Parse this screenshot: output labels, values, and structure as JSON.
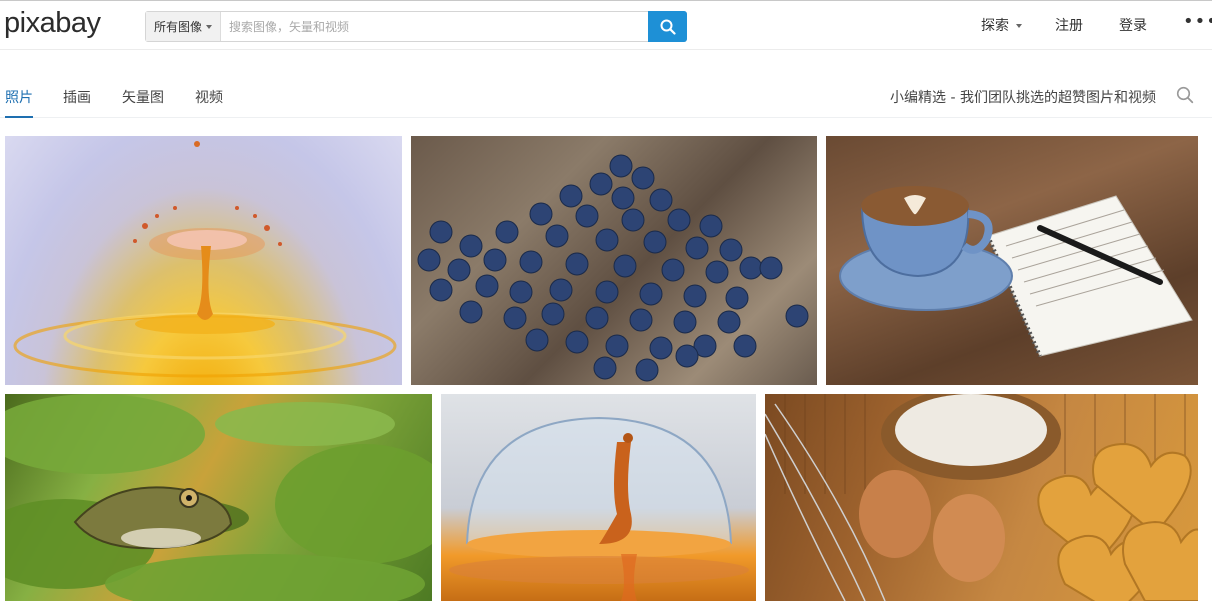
{
  "header": {
    "logo_text": "pixabay",
    "search": {
      "filter_label": "所有图像",
      "placeholder": "搜索图像，矢量和视频",
      "value": ""
    },
    "nav": {
      "explore": "探索",
      "register": "注册",
      "login": "登录",
      "more": "•••"
    }
  },
  "tabs": {
    "items": [
      {
        "label": "照片",
        "active": true
      },
      {
        "label": "插画",
        "active": false
      },
      {
        "label": "矢量图",
        "active": false
      },
      {
        "label": "视频",
        "active": false
      }
    ],
    "editors_choice": "小编精选 - 我们团队挑选的超赞图片和视频"
  },
  "gallery": {
    "photos": [
      {
        "subject": "orange water droplet splash on purple background"
      },
      {
        "subject": "pile of blueberries on a wooden board"
      },
      {
        "subject": "latte art coffee in blue cup with notebook and pen"
      },
      {
        "subject": "frog sitting among green lily pads"
      },
      {
        "subject": "water drop splash inside a bubble"
      },
      {
        "subject": "eggs, flour, whisk and heart-shaped waffles"
      }
    ]
  },
  "colors": {
    "accent": "#1e90d6",
    "tab_active": "#1e6fb0",
    "text": "#333333"
  }
}
